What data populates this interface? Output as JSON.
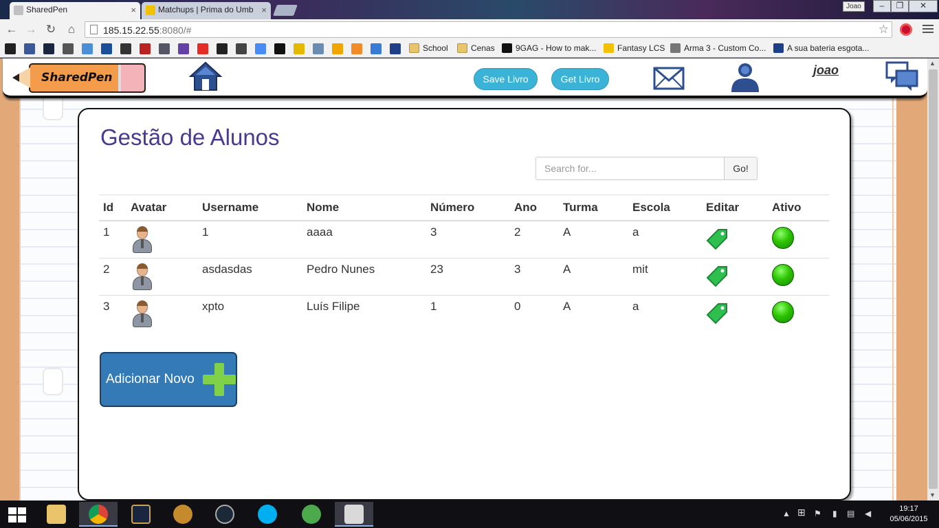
{
  "browser": {
    "tabs": [
      {
        "title": "SharedPen"
      },
      {
        "title": "Matchups | Prima do Umb"
      }
    ],
    "profile": "Joao",
    "url": {
      "host": "185.15.22.55",
      "rest": ":8080/#"
    },
    "bookmarks": [
      {
        "label": "School"
      },
      {
        "label": "Cenas"
      },
      {
        "label": "9GAG - How to mak..."
      },
      {
        "label": "Fantasy LCS"
      },
      {
        "label": "Arma 3 - Custom Co..."
      },
      {
        "label": "A sua bateria esgota..."
      }
    ]
  },
  "header": {
    "logo_text": "SharedPen",
    "save_label": "Save Livro",
    "get_label": "Get Livro",
    "username": "joao"
  },
  "main": {
    "title": "Gestão de Alunos",
    "search": {
      "placeholder": "Search for...",
      "button": "Go!"
    },
    "columns": [
      "Id",
      "Avatar",
      "Username",
      "Nome",
      "Número",
      "Ano",
      "Turma",
      "Escola",
      "Editar",
      "Ativo"
    ],
    "rows": [
      {
        "id": "1",
        "username": "1",
        "nome": "aaaa",
        "numero": "3",
        "ano": "2",
        "turma": "A",
        "escola": "a"
      },
      {
        "id": "2",
        "username": "asdasdas",
        "nome": "Pedro Nunes",
        "numero": "23",
        "ano": "3",
        "turma": "A",
        "escola": "mit"
      },
      {
        "id": "3",
        "username": "xpto",
        "nome": "Luís Filipe",
        "numero": "1",
        "ano": "0",
        "turma": "A",
        "escola": "a"
      }
    ],
    "add_label": "Adicionar Novo"
  },
  "taskbar": {
    "time": "19:17",
    "date": "05/06/2015"
  },
  "colors": {
    "title": "#473a8f",
    "pill": "#3bb3d6",
    "add_button": "#337ab7",
    "paper_margin": "#e2a878",
    "active_green": "#2ec400"
  }
}
